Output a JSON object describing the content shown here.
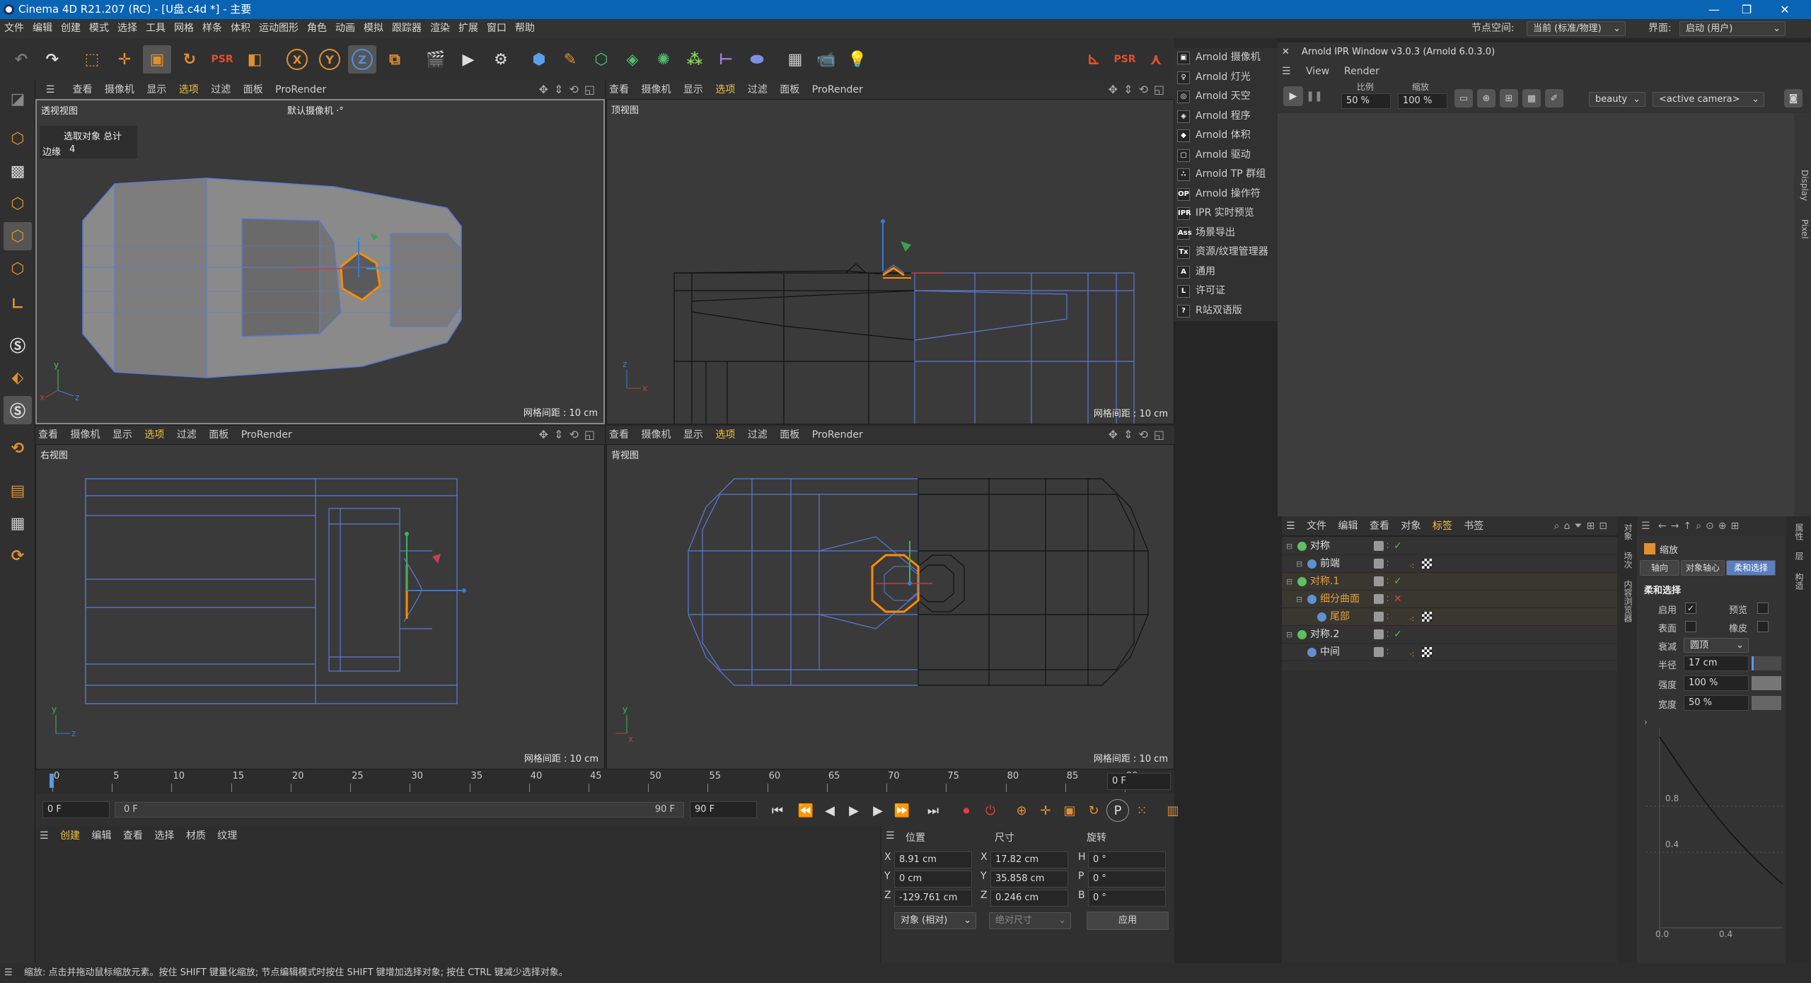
{
  "window": {
    "title": "Cinema 4D R21.207 (RC) - [U盘.c4d *] - 主要",
    "controls": [
      "—",
      "❐",
      "✕"
    ]
  },
  "menubar": {
    "items": [
      "文件",
      "编辑",
      "创建",
      "模式",
      "选择",
      "工具",
      "网格",
      "样条",
      "体积",
      "运动图形",
      "角色",
      "动画",
      "模拟",
      "跟踪器",
      "渲染",
      "扩展",
      "窗口",
      "帮助"
    ],
    "node_space_label": "节点空间:",
    "node_space_value": "当前 (标准/物理)",
    "layout_label": "界面:",
    "layout_value": "启动 (用户)"
  },
  "toolbar": {
    "xyz": [
      "X",
      "Y",
      "Z"
    ]
  },
  "viewports": {
    "menu": [
      "查看",
      "摄像机",
      "显示",
      "选项",
      "过滤",
      "面板",
      "ProRender"
    ],
    "active_menu": "选项",
    "perspective": {
      "label": "透视视图",
      "camera": "默认摄像机 ·°",
      "info_title": "选取对象 总计",
      "info_edges_label": "边缘",
      "info_edges_value": "4",
      "grid": "网格间距 : 10 cm"
    },
    "top": {
      "label": "顶视图",
      "grid": "网格间距 : 10 cm"
    },
    "right": {
      "label": "右视图",
      "grid": "网格间距 : 10 cm"
    },
    "back": {
      "label": "背视图",
      "grid": "网格间距 : 10 cm"
    }
  },
  "timeline": {
    "ticks": [
      "0",
      "5",
      "10",
      "15",
      "20",
      "25",
      "30",
      "35",
      "40",
      "45",
      "50",
      "55",
      "60",
      "65",
      "70",
      "75",
      "80",
      "85",
      "90"
    ],
    "current_frame": "0 F",
    "start": "0 F",
    "range_start": "0 F",
    "range_end": "90 F",
    "end": "90 F"
  },
  "material_manager": {
    "menu": [
      "创建",
      "编辑",
      "查看",
      "选择",
      "材质",
      "纹理"
    ]
  },
  "coords": {
    "headers": [
      "位置",
      "尺寸",
      "旋转"
    ],
    "rows": [
      {
        "axis": "X",
        "pos": "8.91 cm",
        "size_axis": "X",
        "size": "17.82 cm",
        "rot_axis": "H",
        "rot": "0 °"
      },
      {
        "axis": "Y",
        "pos": "0 cm",
        "size_axis": "Y",
        "size": "35.858 cm",
        "rot_axis": "P",
        "rot": "0 °"
      },
      {
        "axis": "Z",
        "pos": "-129.761 cm",
        "size_axis": "Z",
        "size": "0.246 cm",
        "rot_axis": "B",
        "rot": "0 °"
      }
    ],
    "mode": "对象 (相对)",
    "size_mode": "绝对尺寸",
    "apply": "应用"
  },
  "arnold_menu": {
    "items": [
      {
        "icon": "▣",
        "label": "Arnold 摄像机"
      },
      {
        "icon": "♀",
        "label": "Arnold 灯光"
      },
      {
        "icon": "◎",
        "label": "Arnold 天空"
      },
      {
        "icon": "◈",
        "label": "Arnold 程序"
      },
      {
        "icon": "◆",
        "label": "Arnold 体积"
      },
      {
        "icon": "▢",
        "label": "Arnold 驱动"
      },
      {
        "icon": "∴",
        "label": "Arnold TP 群组"
      },
      {
        "icon": "OP",
        "label": "Arnold 操作符"
      },
      {
        "icon": "IPR",
        "label": "IPR 实时预览"
      },
      {
        "icon": "Ass",
        "label": "场景导出"
      },
      {
        "icon": "Tx",
        "label": "资源/纹理管理器"
      },
      {
        "icon": "A",
        "label": "通用"
      },
      {
        "icon": "L",
        "label": "许可证"
      },
      {
        "icon": "?",
        "label": "R站双语版"
      }
    ]
  },
  "ipr": {
    "title": "Arnold IPR Window v3.0.3 (Arnold 6.0.3.0)",
    "menu": [
      "View",
      "Render"
    ],
    "scale_label": "比例",
    "scale_value": "50 %",
    "zoom_label": "缩放",
    "zoom_value": "100 %",
    "aov": "beauty",
    "camera": "<active camera>",
    "side_tabs": [
      "Display",
      "Pixel"
    ]
  },
  "object_manager": {
    "menu": [
      "文件",
      "编辑",
      "查看",
      "对象",
      "标签",
      "书签"
    ],
    "active_menu": "标签",
    "objects": [
      {
        "name": "对称",
        "indent": 0,
        "status": "check",
        "color": "#dddddd"
      },
      {
        "name": "前端",
        "indent": 1,
        "status": "",
        "color": "#dddddd"
      },
      {
        "name": "对称.1",
        "indent": 0,
        "status": "check",
        "color": "#e0a040"
      },
      {
        "name": "细分曲面",
        "indent": 1,
        "status": "cross",
        "color": "#e0a040"
      },
      {
        "name": "尾部",
        "indent": 2,
        "status": "",
        "color": "#e0a040"
      },
      {
        "name": "对称.2",
        "indent": 0,
        "status": "check",
        "color": "#dddddd"
      },
      {
        "name": "中间",
        "indent": 1,
        "status": "",
        "color": "#dddddd"
      }
    ]
  },
  "attributes": {
    "title": "缩放",
    "tabs": [
      "轴向",
      "对象轴心",
      "柔和选择"
    ],
    "section": "柔和选择",
    "enable_label": "启用",
    "preview_label": "预览",
    "surface_label": "表面",
    "rubber_label": "橡皮",
    "falloff_label": "衰减",
    "falloff_value": "圆顶",
    "radius_label": "半径",
    "radius_value": "17 cm",
    "strength_label": "强度",
    "strength_value": "100 %",
    "width_label": "宽度",
    "width_value": "50 %",
    "graph_y": [
      "0.8",
      "0.4"
    ],
    "graph_x": [
      "0.0",
      "0.4"
    ]
  },
  "side_tabs_mid": [
    "对象",
    "场次",
    "内容浏览器"
  ],
  "side_tabs_right": [
    "属性",
    "层",
    "构造"
  ],
  "status": "缩放: 点击并拖动鼠标缩放元素。按住 SHIFT 键量化缩放; 节点编辑模式时按住 SHIFT 键增加选择对象; 按住 CTRL 键减少选择对象。",
  "colors": {
    "accent": "#f0c040",
    "selection": "#ff8c00",
    "wire": "#5c7ad6",
    "title": "#0a64b4"
  }
}
